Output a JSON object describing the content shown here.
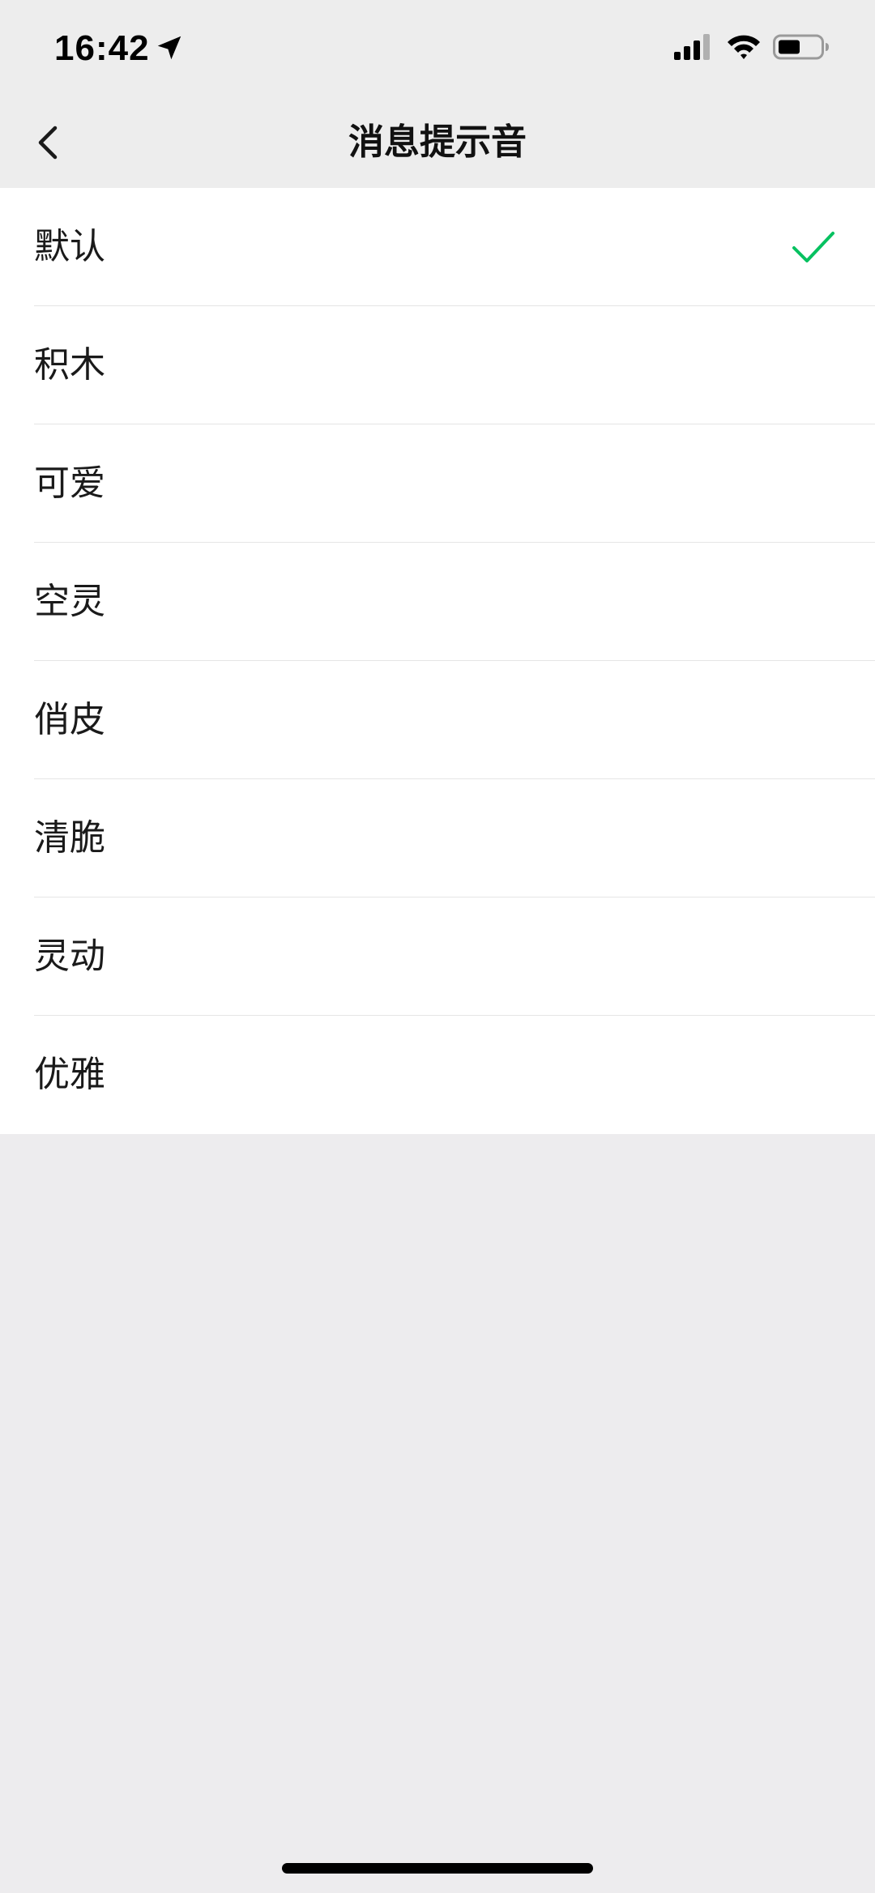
{
  "status_bar": {
    "time": "16:42",
    "icons": [
      "location-arrow-icon",
      "cellular-signal-icon",
      "wifi-icon",
      "battery-icon"
    ]
  },
  "nav": {
    "title": "消息提示音",
    "back_icon": "chevron-left-icon"
  },
  "sounds": [
    {
      "label": "默认",
      "selected": true
    },
    {
      "label": "积木",
      "selected": false
    },
    {
      "label": "可爱",
      "selected": false
    },
    {
      "label": "空灵",
      "selected": false
    },
    {
      "label": "俏皮",
      "selected": false
    },
    {
      "label": "清脆",
      "selected": false
    },
    {
      "label": "灵动",
      "selected": false
    },
    {
      "label": "优雅",
      "selected": false
    }
  ],
  "colors": {
    "accent": "#07C160",
    "background": "#EDECEE",
    "list_background": "#FFFFFF",
    "divider": "#E5E5E5"
  }
}
